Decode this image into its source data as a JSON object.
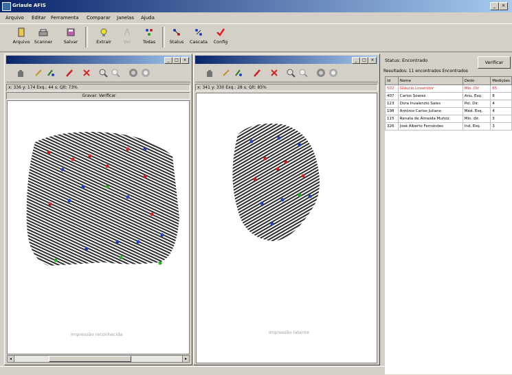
{
  "window": {
    "title": "Griaule AFIS"
  },
  "menu": [
    "Arquivo",
    "Editar",
    "Ferramenta",
    "Comparar",
    "Janelas",
    "Ajuda"
  ],
  "toolbar": [
    "Arquivo",
    "Scanner",
    "Salvar",
    "Extrair",
    "Ver",
    "Todas",
    "Status",
    "Cascata",
    "Config"
  ],
  "left_panel": {
    "status_line": "x: 336  y: 174  Exq.: 44 s; Qlt: 73%",
    "sub_status": "Gravar: Verificar",
    "caption": "Impressão reconhecida"
  },
  "right_panel": {
    "status_line": "x: 341  y: 330  Exq.: 28 s; Qlt: 85%",
    "caption": "Impressão latente"
  },
  "results": {
    "status_label": "Status: Encontrado",
    "verify_button": "Verificar",
    "summary": "Resultados: 11 encontrados Encontrados",
    "headers": [
      "Id",
      "Nome",
      "Dedo",
      "Medições"
    ],
    "rows": [
      {
        "id": "502",
        "name": "Gláucio Linsenitor",
        "finger": "Mín. Dir.",
        "score": "65",
        "highlight": true
      },
      {
        "id": "407",
        "name": "Carlos Soares",
        "finger": "Anu. Esq.",
        "score": "8",
        "highlight": false
      },
      {
        "id": "123",
        "name": "Dora Invalenzio Sales",
        "finger": "Pol. Dir.",
        "score": "4",
        "highlight": false
      },
      {
        "id": "198",
        "name": "Antônio Carlos Juliano",
        "finger": "Méd. Esq.",
        "score": "4",
        "highlight": false
      },
      {
        "id": "115",
        "name": "Renata de Almeida Muñoz",
        "finger": "Mín. dir.",
        "score": "3",
        "highlight": false
      },
      {
        "id": "326",
        "name": "José Alberto Fernandes",
        "finger": "Ind. Esq.",
        "score": "3",
        "highlight": false
      }
    ]
  }
}
